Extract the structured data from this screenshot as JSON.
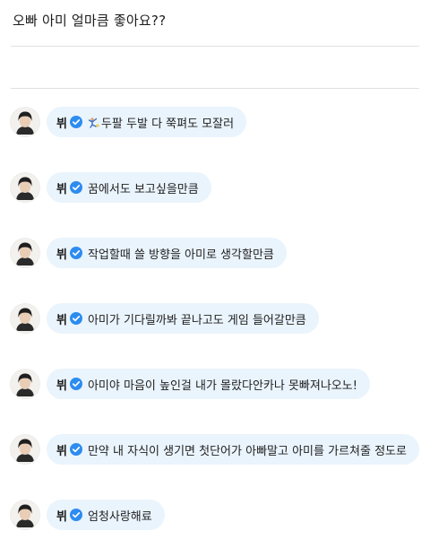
{
  "question": "오빠 아미 얼마큼 좋아요??",
  "sender": {
    "name": "뷔",
    "verified_color": "#2d8cf0",
    "avatar": "profile-photo"
  },
  "bubble_color": "#eaf4fd",
  "messages": [
    {
      "text": "두팔 두발 다 쭉펴도 모잘러",
      "icon": "stretching-person-emoji"
    },
    {
      "text": "꿈에서도 보고싶을만큼"
    },
    {
      "text": "작업할때 쓸 방향을 아미로 생각할만큼"
    },
    {
      "text": "아미가 기다릴까봐 끝나고도 게임 들어갈만큼"
    },
    {
      "text": "아미야 마음이 높인걸 내가 몰랐다안카나 못빠져나오노!"
    },
    {
      "text": "만약 내 자식이 생기면 첫단어가 아빠말고 아미를 가르쳐줄 정도로"
    },
    {
      "text": "엄청사랑해료"
    }
  ]
}
